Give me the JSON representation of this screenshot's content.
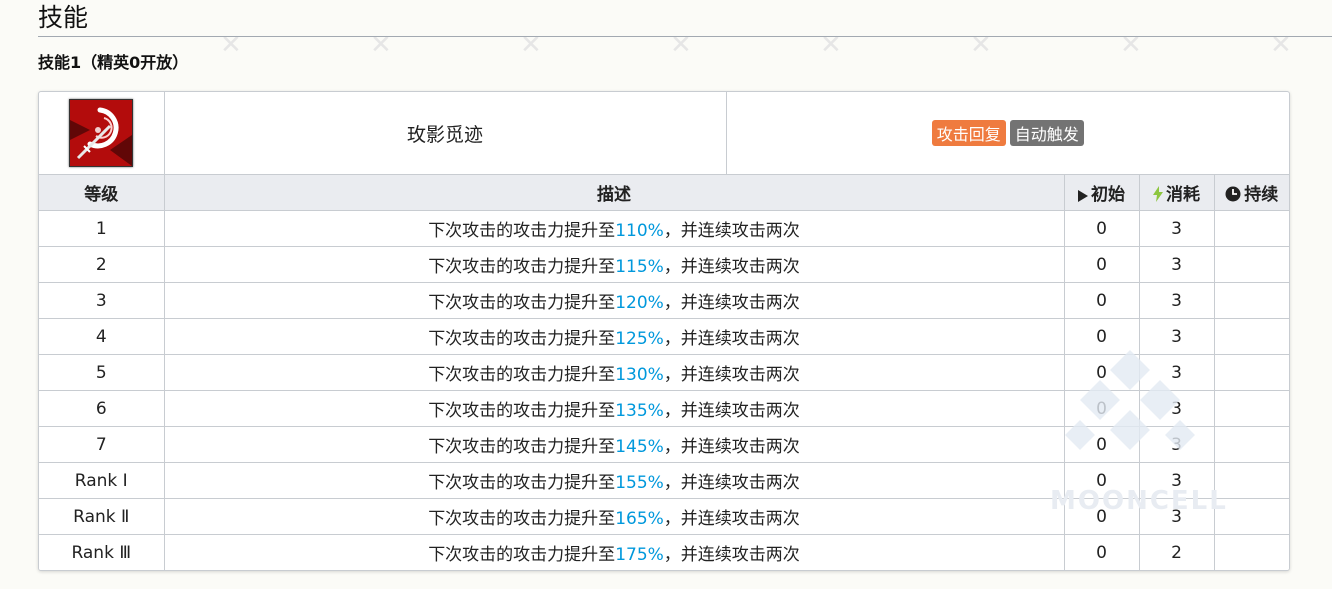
{
  "section": {
    "title": "技能",
    "subtitle": "技能1（精英0开放）"
  },
  "skill": {
    "icon": "skill-icon",
    "name": "玫影觅迹",
    "tags": [
      {
        "label": "攻击回复",
        "color": "#ef7b3f"
      },
      {
        "label": "自动触发",
        "color": "#737373"
      }
    ]
  },
  "table": {
    "headers": {
      "level": "等级",
      "desc": "描述",
      "initial": "初始",
      "cost": "消耗",
      "duration": "持续"
    },
    "desc_prefix": "下次攻击的攻击力提升至",
    "desc_suffix": "，并连续攻击两次",
    "rows": [
      {
        "level": "1",
        "value": "110%",
        "initial": "0",
        "cost": "3",
        "duration": ""
      },
      {
        "level": "2",
        "value": "115%",
        "initial": "0",
        "cost": "3",
        "duration": ""
      },
      {
        "level": "3",
        "value": "120%",
        "initial": "0",
        "cost": "3",
        "duration": ""
      },
      {
        "level": "4",
        "value": "125%",
        "initial": "0",
        "cost": "3",
        "duration": ""
      },
      {
        "level": "5",
        "value": "130%",
        "initial": "0",
        "cost": "3",
        "duration": ""
      },
      {
        "level": "6",
        "value": "135%",
        "initial": "0",
        "cost": "3",
        "duration": ""
      },
      {
        "level": "7",
        "value": "145%",
        "initial": "0",
        "cost": "3",
        "duration": ""
      },
      {
        "level": "Rank Ⅰ",
        "value": "155%",
        "initial": "0",
        "cost": "3",
        "duration": ""
      },
      {
        "level": "Rank Ⅱ",
        "value": "165%",
        "initial": "0",
        "cost": "3",
        "duration": ""
      },
      {
        "level": "Rank Ⅲ",
        "value": "175%",
        "initial": "0",
        "cost": "2",
        "duration": ""
      }
    ]
  },
  "watermark": "MOONCELL"
}
